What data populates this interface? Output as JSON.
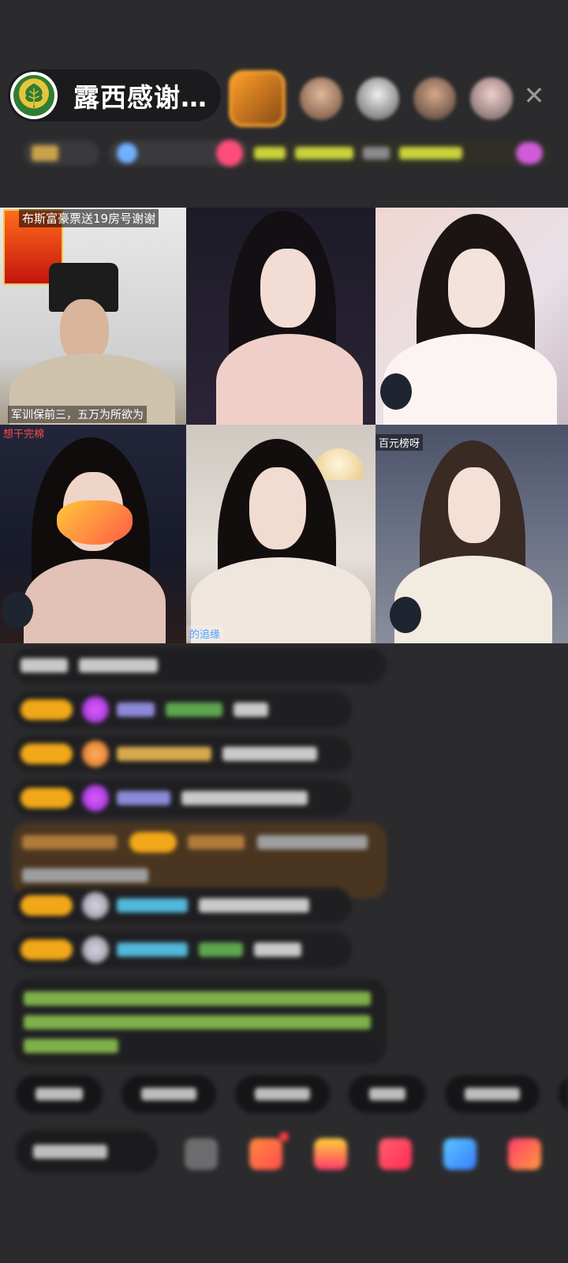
{
  "room": {
    "title": "露西感谢…",
    "avatar_icon": "tree-logo-icon"
  },
  "audience": {
    "avatars": [
      "viewer-1",
      "viewer-2",
      "viewer-3",
      "viewer-4",
      "viewer-5"
    ],
    "close_icon": "close-icon",
    "close_glyph": "✕"
  },
  "video_grid": {
    "cells": [
      {
        "caption_top": "布斯富豪票送19房号谢谢",
        "caption_bottom": "军训保前三，五万为所欲为"
      },
      {
        "caption_top": "",
        "caption_bottom": ""
      },
      {
        "caption_top": "",
        "caption_bottom": ""
      },
      {
        "caption_top": "想干完棉",
        "caption_bottom": ""
      },
      {
        "caption_top": "",
        "caption_bottom": "的追缘"
      },
      {
        "caption_top": "百元榜呀",
        "caption_bottom": ""
      }
    ]
  },
  "colors": {
    "background": "#2b2b2d",
    "level_badge": "#f1a818",
    "close": "#9a9a9a"
  }
}
